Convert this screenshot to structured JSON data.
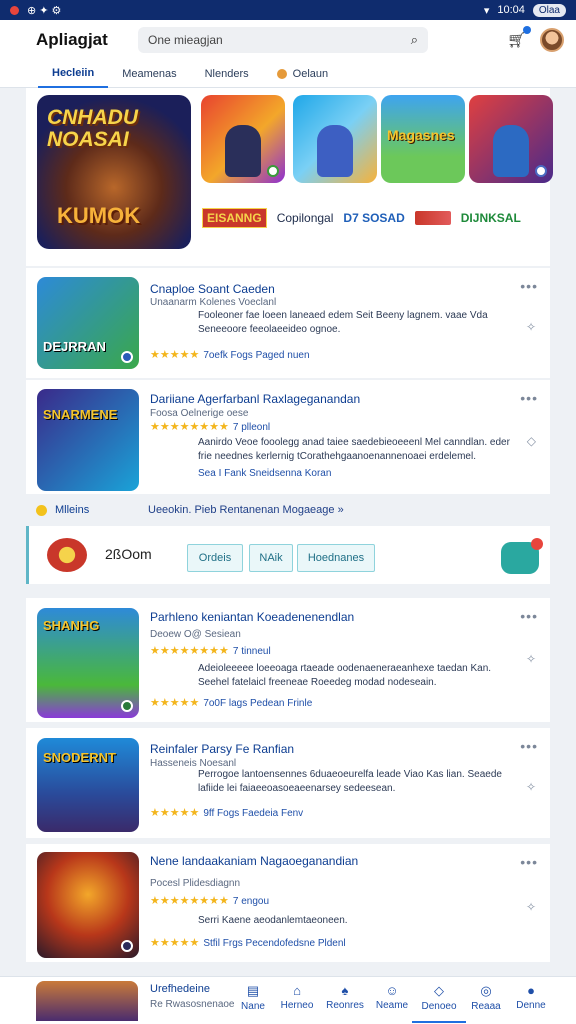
{
  "statusbar": {
    "left_icons": "⊕ ✦ ⚙",
    "time": "10:04",
    "pill": "Olaa"
  },
  "header": {
    "app_title": "Apliagjat",
    "search_placeholder": "One mieagjan"
  },
  "tabs": [
    {
      "label": "Hecleiin",
      "active": true
    },
    {
      "label": "Meamenas"
    },
    {
      "label": "Nlenders"
    },
    {
      "label": "Oelaun"
    }
  ],
  "featured": {
    "hero_title": "CNHADU NOASAI",
    "hero_subtitle": "KUMOK",
    "thumbs": [
      "",
      "",
      "Magasnes",
      ""
    ],
    "brands": [
      "EISANNG",
      "Copilongal",
      "D7 SOSAD",
      "DIJNKSAL"
    ]
  },
  "apps": [
    {
      "title": "Cnaploe Soant  Caeden",
      "sub": "Unaanarm  Kolenes Voeclanl",
      "desc": "Fooleoner fae loeen laneaed edem  Seit Beeny lagnem.  vaae  Vda Seneeoore feeolaeeideo ognoe.",
      "rating": "7oefk Fogs Paged nuen",
      "icon_label": "DEJRRAN"
    },
    {
      "title": "Dariiane Agerfarbanl  Raxlageganandan",
      "sub": "Foosa Oelnerige oese",
      "desc": "Aanirdo Veoe  fooolegg  anad  taiee saedebieoeeenl  Mel canndlan. eder frie neednes kerlernig tCorathehgaanoenannenoaei  erdelemel.",
      "rating": "Sea  I Fank  Sneidsenna Koran",
      "stars_text": "7 plleonl",
      "icon_label": "SNARMENE"
    },
    {
      "title": "Parhleno keniantan  Koeadenenendlan",
      "sub": "Deoew O@ Sesiean",
      "desc": "Adeioleeeee  loeeoaga  rtaeade oodenaeneraeanhexe  taedan  Kan. Seehel  fatelaicl freeneae Roeedeg modad nodeseain.",
      "rating": "7o0F lags  Pedean Frinle",
      "stars_text": "7 tinneul",
      "icon_label": "SHANHG"
    },
    {
      "title": "Reinfaler Parsy Fe  Ranfian",
      "sub": "Hasseneis  Noesanl",
      "desc": "Perrogoe  lantoensennes  6duaeoeurelfa  leade  Viao  Kas  lian. Seaede  lafiide lei  faiaeeoasoeaeenarsey  sedeesean.",
      "rating": "9ff Fogs Faedeia Fenv",
      "icon_label": "SNODERNT"
    },
    {
      "title": "Nene landaakaniam  Nagaoeganandian",
      "sub": "Pocesl  Plidesdiagnn",
      "desc": "Serri Kaene  aeodanlemtaeoneen.",
      "rating": "Stfil Frgs  Pecendofedsne Pldenl",
      "stars_text": "7 engou",
      "icon_label": ""
    }
  ],
  "section": {
    "left": "Mlleins",
    "right": "Ueeokin.  Pieb  Rentanenan  Mogaeage »"
  },
  "filterbar": {
    "time": "2ßOom",
    "chips": [
      "Ordeis",
      "NAik",
      "Hoednanes"
    ]
  },
  "bottomnav": {
    "title": "Urefhedeine",
    "sub": "Re Rwasosnenaoe",
    "items": [
      "Nane",
      "Herneo",
      "Reonres",
      "Neame",
      "Denoeo",
      "Reaaa",
      "Denne"
    ],
    "icons": [
      "▤",
      "⌂",
      "♠",
      "☺",
      "◇",
      "◎",
      "●"
    ],
    "active_index": 4
  },
  "colors": {
    "primary": "#0d3d91",
    "accent": "#1f6fe0",
    "star": "#f3b51c",
    "teal": "#2aa8a0"
  }
}
